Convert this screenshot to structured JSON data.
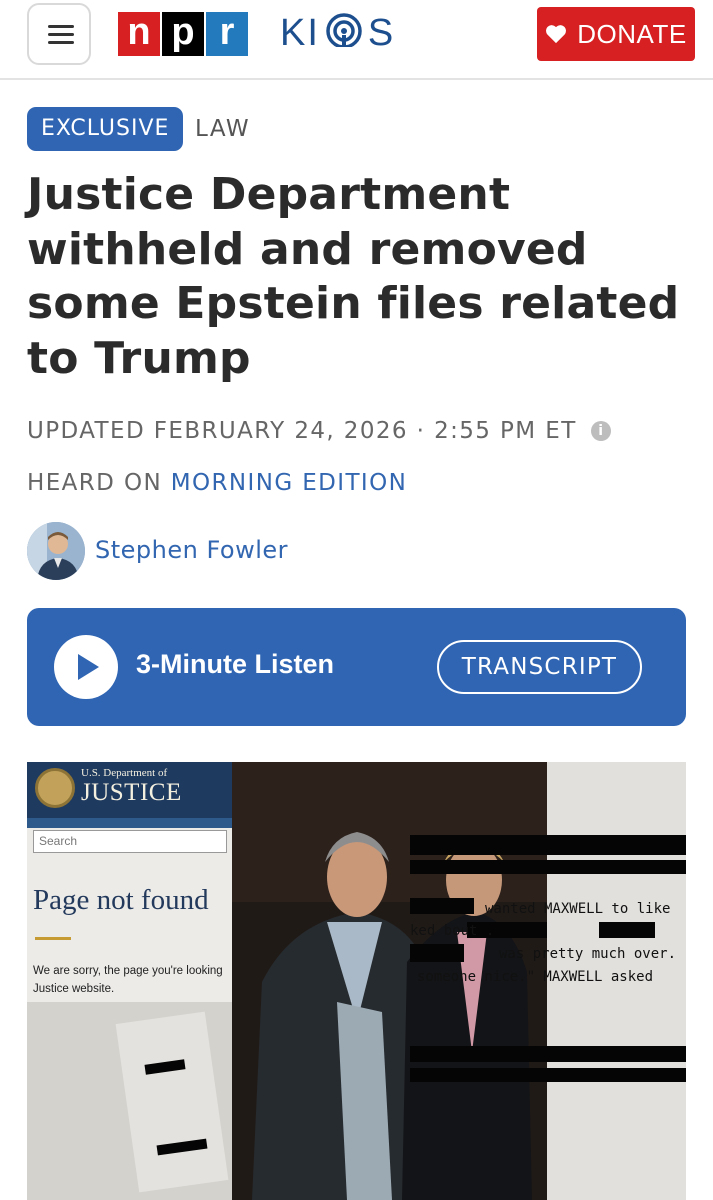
{
  "header": {
    "menu_icon": "hamburger-menu-icon",
    "npr_letters": [
      "n",
      "p",
      "r"
    ],
    "station_name_left": "KI",
    "station_name_right": "S",
    "donate_label": "DONATE",
    "donate_icon": "heart-icon",
    "colors": {
      "npr_red": "#d62021",
      "npr_black": "#000000",
      "npr_blue": "#237bbd",
      "station_blue": "#1d4f8e"
    }
  },
  "article": {
    "badge": "EXCLUSIVE",
    "section": "LAW",
    "headline": "Justice Department withheld and removed some Epstein files related to Trump",
    "updated": "UPDATED FEBRUARY 24, 2026 · 2:55 PM ET",
    "info_icon": "info-icon",
    "heard_on_label": "HEARD ON",
    "heard_on_show": "MORNING EDITION",
    "author": "Stephen Fowler"
  },
  "player": {
    "play_icon": "play-icon",
    "listen_label": "3-Minute Listen",
    "transcript_label": "TRANSCRIPT",
    "color": "#2f65b3"
  },
  "image": {
    "doj_small": "U.S. Department of",
    "doj_big": "JUSTICE",
    "search_placeholder": "Search",
    "page_not_found": "Page not found",
    "sorry_text": "We are sorry, the page you're looking Justice website.",
    "doc_line1": "wanted MAXWELL to like",
    "doc_line2": "ked                bout       .",
    "doc_line3": "was pretty much over.",
    "doc_line4": "someone nice.\"  MAXWELL asked"
  }
}
